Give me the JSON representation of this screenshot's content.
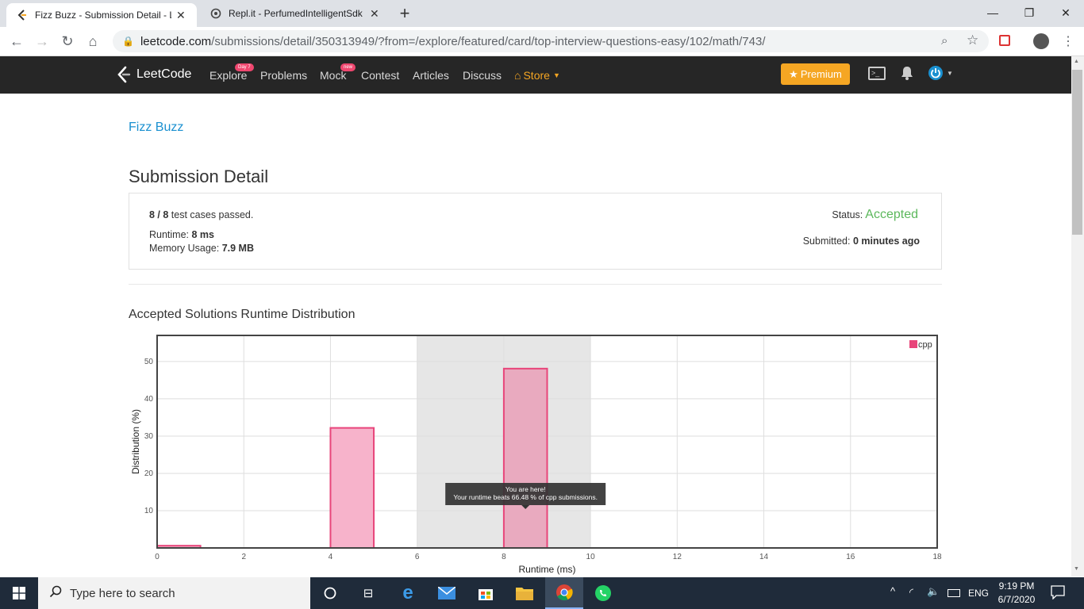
{
  "browser": {
    "tabs": [
      {
        "title": "Fizz Buzz - Submission Detail - LeetCode",
        "active": true
      },
      {
        "title": "Repl.it - PerfumedIntelligentSdk",
        "active": false
      }
    ],
    "new_tab": "+",
    "url_host": "leetcode.com",
    "url_path": "/submissions/detail/350313949/?from=/explore/featured/card/top-interview-questions-easy/102/math/743/"
  },
  "nav": {
    "logo": "LeetCode",
    "links": [
      "Explore",
      "Problems",
      "Mock",
      "Contest",
      "Articles",
      "Discuss"
    ],
    "explore_badge": "Day 7",
    "mock_badge": "new",
    "store": "Store",
    "premium": "Premium",
    "colors": {
      "bar": "#262626",
      "store": "#f5a623",
      "premium": "#f5a623"
    }
  },
  "page": {
    "problem_title": "Fizz Buzz",
    "heading": "Submission Detail",
    "passed_count": "8 / 8",
    "passed_suffix": " test cases passed.",
    "runtime_label": "Runtime: ",
    "runtime_value": "8 ms",
    "memory_label": "Memory Usage: ",
    "memory_value": "7.9 MB",
    "status_label": "Status: ",
    "status_value": "Accepted",
    "submitted_label": "Submitted: ",
    "submitted_value": "0 minutes ago",
    "chart_title": "Accepted Solutions Runtime Distribution"
  },
  "chart_data": {
    "type": "bar",
    "xlabel": "Runtime (ms)",
    "ylabel": "Distribution (%)",
    "xlim": [
      0,
      18
    ],
    "ylim": [
      0,
      57
    ],
    "xticks": [
      0,
      2,
      4,
      6,
      8,
      10,
      12,
      14,
      16,
      18
    ],
    "yticks": [
      10,
      20,
      30,
      40,
      50
    ],
    "grid": true,
    "legend": {
      "label": "cpp",
      "position": "top-right"
    },
    "highlight_range": [
      6,
      10
    ],
    "series": [
      {
        "name": "cpp",
        "bars": [
          {
            "x0": 0,
            "x1": 1,
            "value": 0.6
          },
          {
            "x0": 4,
            "x1": 5,
            "value": 32.2
          },
          {
            "x0": 8,
            "x1": 9,
            "value": 48.1
          }
        ]
      }
    ],
    "highlighted_bar_index": 2,
    "tooltip": {
      "line1": "You are here!",
      "line2": "Your runtime beats 66.48 % of cpp submissions."
    },
    "colors": {
      "bar_fill": "#f7b3cb",
      "bar_stroke": "#e8457a",
      "highlight_bar_fill": "#e9aabf",
      "highlight_band": "#e6e6e6"
    }
  },
  "taskbar": {
    "search_placeholder": "Type here to search",
    "lang": "ENG",
    "time": "9:19 PM",
    "date": "6/7/2020"
  }
}
